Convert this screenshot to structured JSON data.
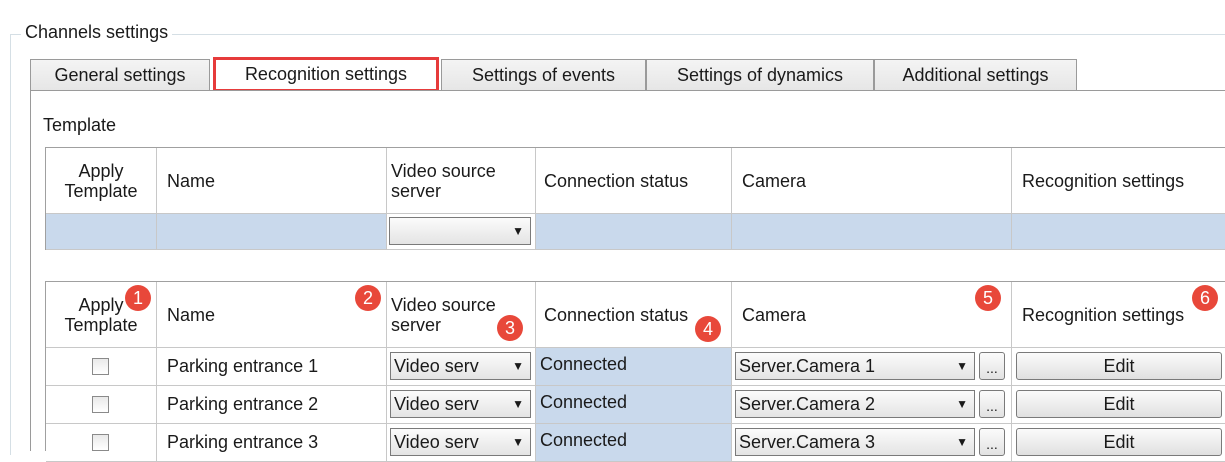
{
  "group": {
    "title": "Channels settings"
  },
  "tabs": [
    {
      "label": "General settings"
    },
    {
      "label": "Recognition settings",
      "active": true
    },
    {
      "label": "Settings of events"
    },
    {
      "label": "Settings of dynamics"
    },
    {
      "label": "Additional settings"
    }
  ],
  "template_section": {
    "label": "Template",
    "columns": {
      "apply": "Apply Template",
      "name": "Name",
      "server": "Video source server",
      "status": "Connection status",
      "camera": "Camera",
      "recognition": "Recognition settings"
    }
  },
  "channels": {
    "columns": {
      "apply": "Apply Template",
      "name": "Name",
      "server": "Video source server",
      "status": "Connection status",
      "camera": "Camera",
      "recognition": "Recognition settings"
    },
    "rows": [
      {
        "name": "Parking entrance 1",
        "server": "Video serv",
        "status": "Connected",
        "camera": "Server.Camera 1",
        "dots": "...",
        "edit": "Edit"
      },
      {
        "name": "Parking entrance 2",
        "server": "Video serv",
        "status": "Connected",
        "camera": "Server.Camera 2",
        "dots": "...",
        "edit": "Edit"
      },
      {
        "name": "Parking entrance 3",
        "server": "Video serv",
        "status": "Connected",
        "camera": "Server.Camera 3",
        "dots": "...",
        "edit": "Edit"
      }
    ]
  },
  "badges": [
    "1",
    "2",
    "3",
    "4",
    "5",
    "6"
  ],
  "colors": {
    "highlight_border": "#e63b3b",
    "badge": "#e8483a",
    "cell_blue": "#c9d9ec"
  },
  "icons": {
    "dropdown": "chevron-down-icon"
  }
}
